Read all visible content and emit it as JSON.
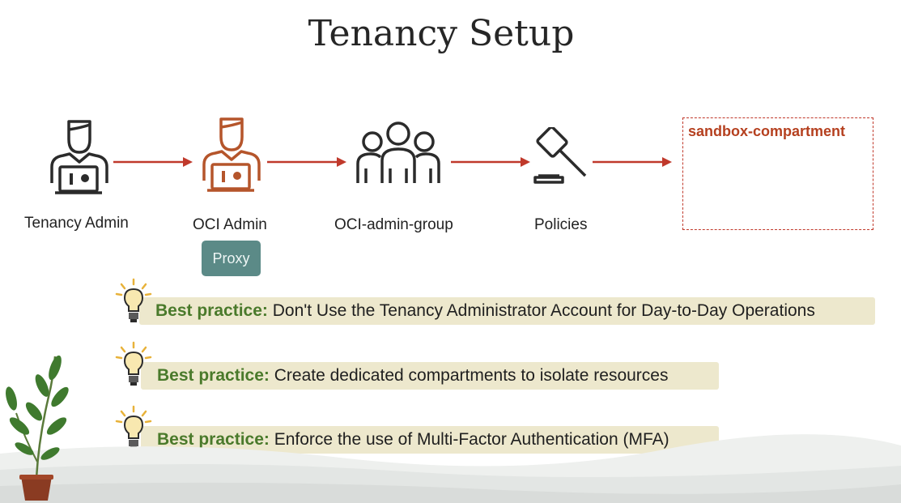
{
  "title": "Tenancy Setup",
  "nodes": [
    {
      "label": "Tenancy Admin",
      "icon": "admin-user-icon"
    },
    {
      "label": "OCI Admin",
      "icon": "admin-user-icon"
    },
    {
      "label": "OCI-admin-group",
      "icon": "user-group-icon"
    },
    {
      "label": "Policies",
      "icon": "gavel-icon"
    }
  ],
  "proxy_label": "Proxy",
  "sandbox_label": "sandbox-compartment",
  "best_practices": [
    {
      "prefix": "Best practice:",
      "text": "Don't Use the Tenancy Administrator Account for Day-to-Day Operations"
    },
    {
      "prefix": "Best practice:",
      "text": "Create dedicated compartments to isolate resources"
    },
    {
      "prefix": "Best practice:",
      "text": "Enforce the use of Multi-Factor Authentication (MFA)"
    }
  ],
  "colors": {
    "arrow": "#c0392b",
    "oci_admin_icon": "#b5552b",
    "dark_icon": "#2b2b2b",
    "proxy_bg": "#5b8a87",
    "best_practice_bg": "#ede8cd",
    "best_practice_accent": "#4a7a2b",
    "sandbox_border": "#c0392b"
  }
}
